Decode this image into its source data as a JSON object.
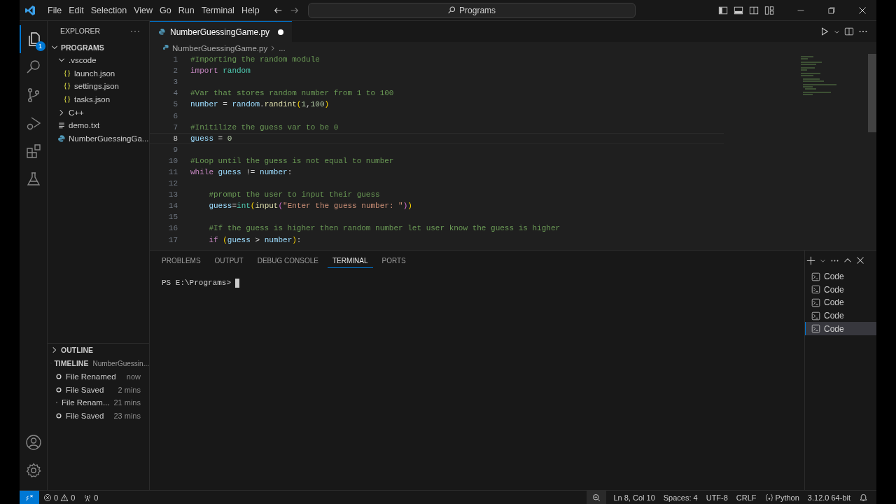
{
  "title_bar": {
    "menu": [
      "File",
      "Edit",
      "Selection",
      "View",
      "Go",
      "Run",
      "Terminal",
      "Help"
    ],
    "search": "Programs"
  },
  "activity_bar": {
    "explorer_badge": "1"
  },
  "sidebar": {
    "title": "EXPLORER",
    "more": "···",
    "root": {
      "label": "PROGRAMS",
      "expanded": true,
      "children": [
        {
          "label": ".vscode",
          "kind": "folder",
          "expanded": true,
          "children": [
            {
              "label": "launch.json",
              "kind": "json"
            },
            {
              "label": "settings.json",
              "kind": "json"
            },
            {
              "label": "tasks.json",
              "kind": "json"
            }
          ]
        },
        {
          "label": "C++",
          "kind": "folder",
          "expanded": false
        },
        {
          "label": "demo.txt",
          "kind": "text"
        },
        {
          "label": "NumberGuessingGa...",
          "kind": "python"
        }
      ]
    },
    "outline": {
      "label": "OUTLINE",
      "expanded": false
    },
    "timeline": {
      "label": "TIMELINE",
      "expanded": true,
      "file": "NumberGuessin...",
      "items": [
        {
          "label": "File Renamed",
          "time": "now"
        },
        {
          "label": "File Saved",
          "time": "2 mins"
        },
        {
          "label": "File Renam...",
          "time": "21 mins"
        },
        {
          "label": "File Saved",
          "time": "23 mins"
        }
      ]
    }
  },
  "editor": {
    "tab": {
      "label": "NumberGuessingGame.py",
      "modified": true
    },
    "breadcrumb": [
      "NumberGuessingGame.py",
      "..."
    ],
    "lines": [
      {
        "num": "1",
        "current": false,
        "tokens": [
          {
            "t": "#Importing the random module",
            "kind": "comment"
          }
        ]
      },
      {
        "num": "2",
        "current": false,
        "tokens": [
          {
            "t": "import",
            "kind": "keyword"
          },
          {
            "t": " random",
            "kind": "module"
          }
        ]
      },
      {
        "num": "3",
        "current": false
      },
      {
        "num": "4",
        "current": false,
        "tokens": [
          {
            "t": "#Var that stores random number from 1 to 100",
            "kind": "comment"
          }
        ]
      },
      {
        "num": "5",
        "current": false,
        "tokens": [
          {
            "t": "number",
            "kind": "var"
          },
          {
            "t": " = ",
            "kind": "plain"
          },
          {
            "t": "random",
            "kind": "var"
          },
          {
            "t": ".",
            "kind": "plain"
          },
          {
            "t": "randint",
            "kind": "func"
          },
          {
            "t": "(",
            "kind": "paren"
          },
          {
            "t": "1",
            "kind": "num"
          },
          {
            "t": ",",
            "kind": "plain"
          },
          {
            "t": "100",
            "kind": "num"
          },
          {
            "t": ")",
            "kind": "paren"
          }
        ]
      },
      {
        "num": "6",
        "current": false
      },
      {
        "num": "7",
        "current": false,
        "tokens": [
          {
            "t": "#Initilize the guess var to be 0",
            "kind": "comment"
          }
        ]
      },
      {
        "num": "8",
        "current": true,
        "tokens": [
          {
            "t": "guess",
            "kind": "var"
          },
          {
            "t": " = ",
            "kind": "plain"
          },
          {
            "t": "0",
            "kind": "num"
          }
        ]
      },
      {
        "num": "9",
        "current": false
      },
      {
        "num": "10",
        "current": false,
        "tokens": [
          {
            "t": "#Loop until the guess is not equal to number",
            "kind": "comment"
          }
        ]
      },
      {
        "num": "11",
        "current": false,
        "tokens": [
          {
            "t": "while",
            "kind": "keyword"
          },
          {
            "t": " guess",
            "kind": "var"
          },
          {
            "t": " != ",
            "kind": "plain"
          },
          {
            "t": "number",
            "kind": "var"
          },
          {
            "t": ":",
            "kind": "plain"
          }
        ]
      },
      {
        "num": "12",
        "current": false
      },
      {
        "num": "13",
        "current": false,
        "tokens": [
          {
            "t": "    #prompt the user to input their guess",
            "kind": "comment"
          }
        ]
      },
      {
        "num": "14",
        "current": false,
        "tokens": [
          {
            "t": "    guess",
            "kind": "var"
          },
          {
            "t": "=",
            "kind": "plain"
          },
          {
            "t": "int",
            "kind": "module"
          },
          {
            "t": "(",
            "kind": "paren"
          },
          {
            "t": "input",
            "kind": "func"
          },
          {
            "t": "(",
            "kind": "paren2"
          },
          {
            "t": "\"Enter the guess number: \"",
            "kind": "str"
          },
          {
            "t": ")",
            "kind": "paren2"
          },
          {
            "t": ")",
            "kind": "paren"
          }
        ]
      },
      {
        "num": "15",
        "current": false
      },
      {
        "num": "16",
        "current": false,
        "tokens": [
          {
            "t": "    #If the guess is higher then random number let user know the guess is higher",
            "kind": "comment"
          }
        ]
      },
      {
        "num": "17",
        "current": false,
        "tokens": [
          {
            "t": "    if",
            "kind": "keyword"
          },
          {
            "t": " (",
            "kind": "paren"
          },
          {
            "t": "guess",
            "kind": "var"
          },
          {
            "t": " > ",
            "kind": "plain"
          },
          {
            "t": "number",
            "kind": "var"
          },
          {
            "t": ")",
            "kind": "paren"
          },
          {
            "t": ":",
            "kind": "plain"
          }
        ]
      }
    ]
  },
  "panel": {
    "tabs": [
      {
        "label": "PROBLEMS",
        "selected": false
      },
      {
        "label": "OUTPUT",
        "selected": false
      },
      {
        "label": "DEBUG CONSOLE",
        "selected": false
      },
      {
        "label": "TERMINAL",
        "selected": true
      },
      {
        "label": "PORTS",
        "selected": false
      }
    ],
    "prompt": "PS E:\\Programs>",
    "terminals": [
      {
        "label": "Code",
        "selected": false
      },
      {
        "label": "Code",
        "selected": false
      },
      {
        "label": "Code",
        "selected": false
      },
      {
        "label": "Code",
        "selected": false
      },
      {
        "label": "Code",
        "selected": true
      }
    ]
  },
  "status_bar": {
    "errors": "0",
    "warnings": "0",
    "ports": "0",
    "position": "Ln 8, Col 10",
    "spaces": "Spaces: 4",
    "encoding": "UTF-8",
    "eol": "CRLF",
    "language": "Python",
    "interpreter": "3.12.0 64-bit"
  }
}
